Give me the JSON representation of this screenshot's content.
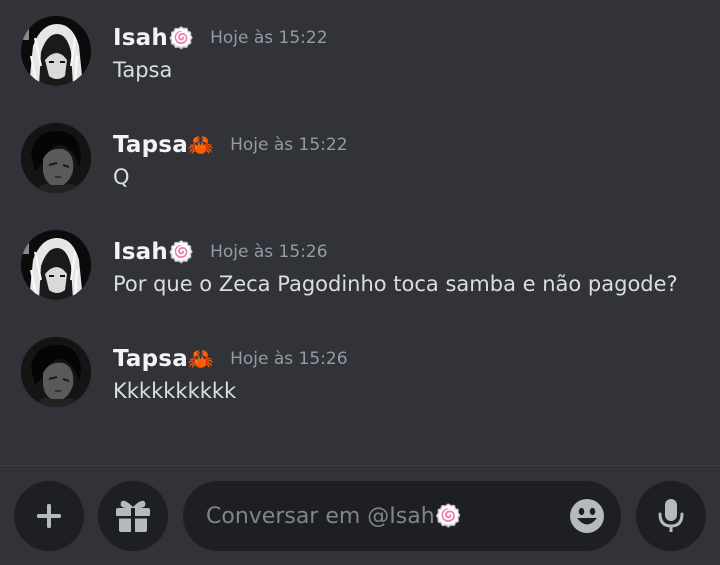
{
  "messages": [
    {
      "username": "Isah",
      "badge": "🍥",
      "timestamp": "Hoje às 15:22",
      "content": "Tapsa"
    },
    {
      "username": "Tapsa",
      "badge": "🦀",
      "timestamp": "Hoje às 15:22",
      "content": "Q"
    },
    {
      "username": "Isah",
      "badge": "🍥",
      "timestamp": "Hoje às 15:26",
      "content": "Por que o Zeca Pagodinho toca samba e não pagode?"
    },
    {
      "username": "Tapsa",
      "badge": "🦀",
      "timestamp": "Hoje às 15:26",
      "content": "Kkkkkkkkkk"
    }
  ],
  "composer": {
    "placeholder": "Conversar em @Isah🍥",
    "add_icon": "plus-icon",
    "gift_icon": "gift-icon",
    "emoji_icon": "smile-icon",
    "mic_icon": "microphone-icon"
  },
  "colors": {
    "background": "#313338",
    "input_background": "#1e1f22",
    "username": "#f2f3f5",
    "message_text": "#dbdee1",
    "timestamp": "#949ba4",
    "icon": "#b5bac1"
  }
}
